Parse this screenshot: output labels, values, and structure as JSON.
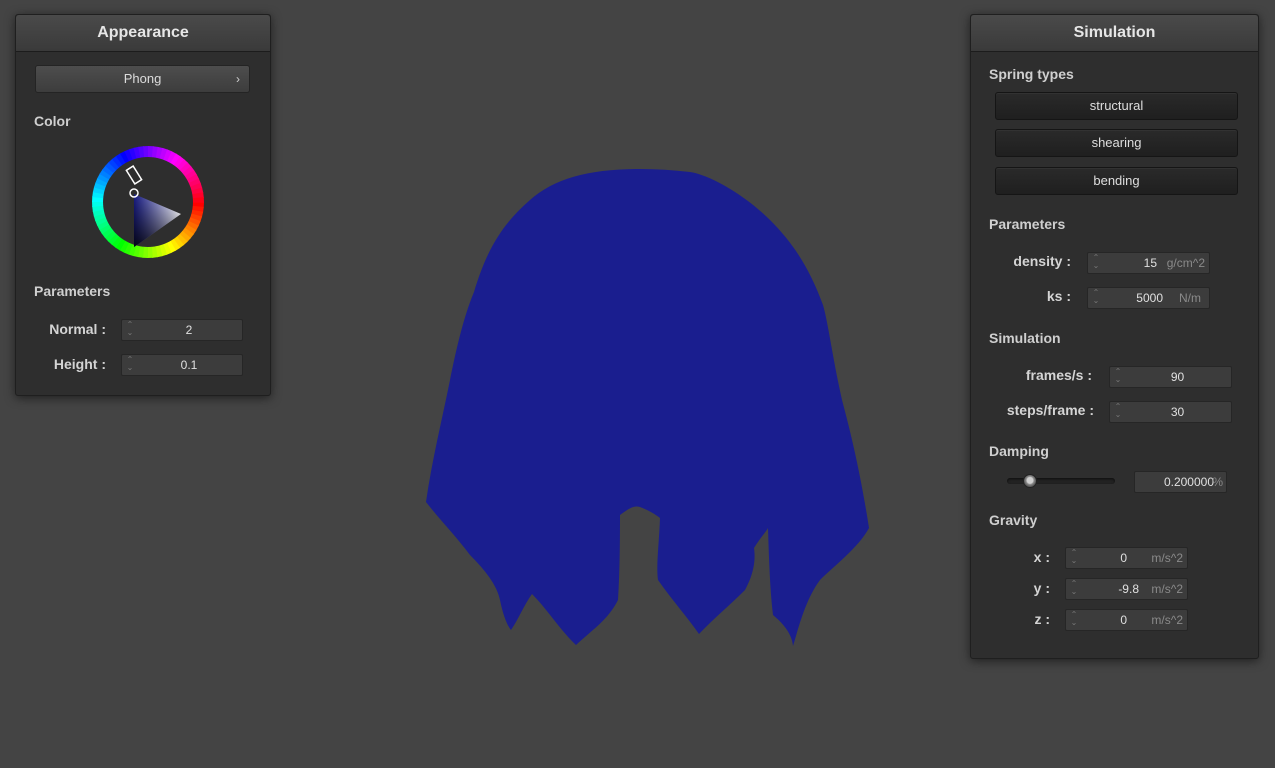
{
  "appearance": {
    "title": "Appearance",
    "shader": "Phong",
    "color_label": "Color",
    "color_hex": "#1a1e8f",
    "params_label": "Parameters",
    "normal_label": "Normal :",
    "normal_value": "2",
    "height_label": "Height :",
    "height_value": "0.1"
  },
  "simulation": {
    "title": "Simulation",
    "spring_label": "Spring types",
    "spring_buttons": [
      "structural",
      "shearing",
      "bending"
    ],
    "params_label": "Parameters",
    "density_label": "density :",
    "density_value": "15",
    "density_unit": "g/cm^2",
    "ks_label": "ks :",
    "ks_value": "5000",
    "ks_unit": "N/m",
    "sim_label": "Simulation",
    "fps_label": "frames/s :",
    "fps_value": "90",
    "steps_label": "steps/frame :",
    "steps_value": "30",
    "damping_label": "Damping",
    "damping_value": "0.200000",
    "damping_unit": "%",
    "damping_fraction": 0.2,
    "gravity_label": "Gravity",
    "gx_label": "x :",
    "gx_value": "0",
    "gy_label": "y :",
    "gy_value": "-9.8",
    "gz_label": "z :",
    "gz_value": "0",
    "gravity_unit": "m/s^2"
  },
  "colors": {
    "background": "#444444",
    "cloth": "#1a1e8f",
    "panel": "#2e2e2e"
  }
}
